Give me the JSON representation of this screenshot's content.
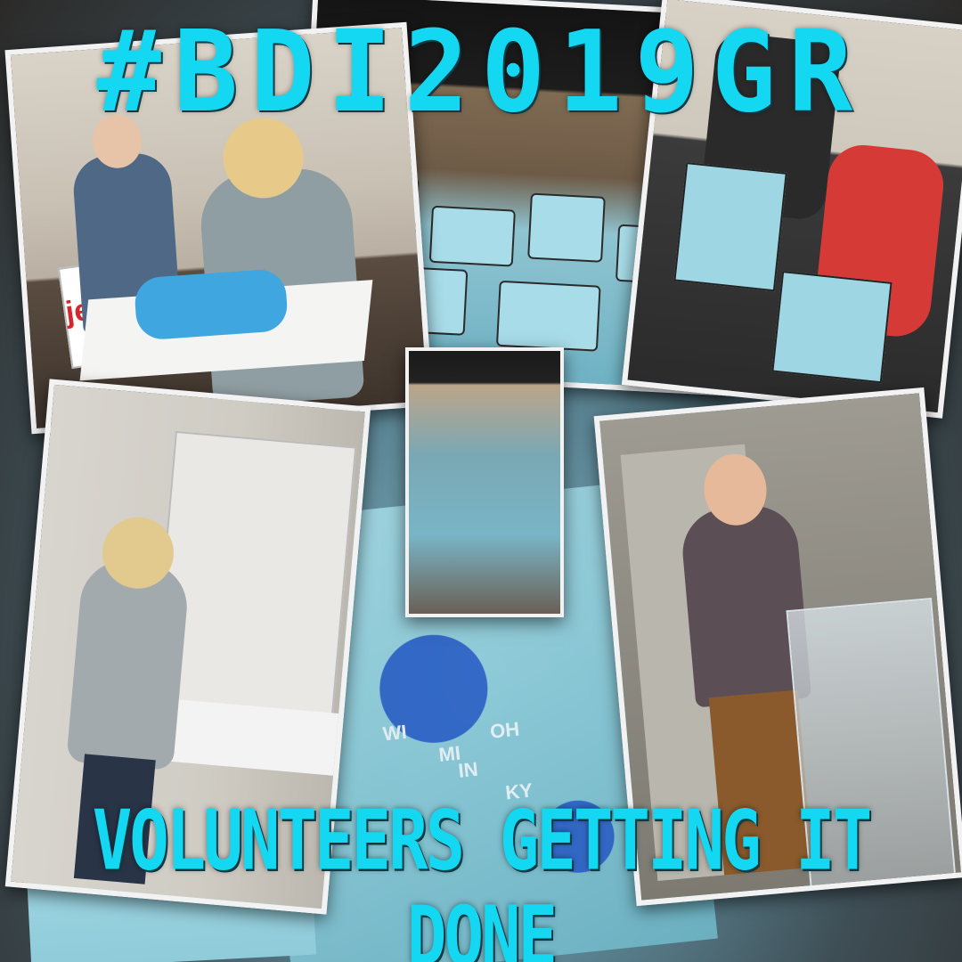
{
  "title": "#BDI2019GR",
  "caption": "VOLUNTEERS GETTING IT DONE",
  "bag_sign_text": "jer",
  "bag_map_labels": [
    "WI",
    "MI",
    "OH",
    "IN",
    "KY"
  ],
  "colors": {
    "title_text": "#14d7f2",
    "bag_light_blue": "#a6dbe6",
    "bag_map_blue": "#2d63c9",
    "jacket_red": "#d63a37"
  },
  "photos": [
    {
      "name": "photo-volunteers-folding-shirts"
    },
    {
      "name": "photo-bags-on-floor-stage"
    },
    {
      "name": "photo-volunteers-stacking-bags"
    },
    {
      "name": "photo-woman-at-table"
    },
    {
      "name": "photo-bag-pile-overview"
    },
    {
      "name": "photo-speaker-at-podium"
    }
  ]
}
